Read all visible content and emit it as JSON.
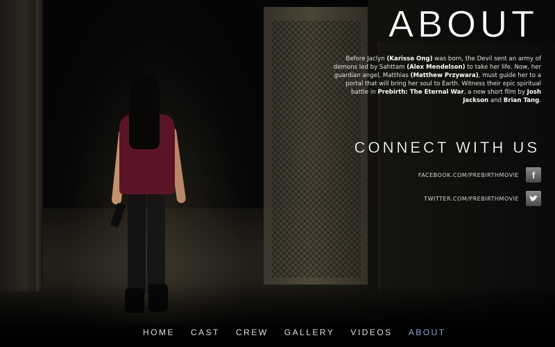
{
  "about": {
    "title": "ABOUT",
    "synopsis": [
      {
        "text": "Before Jaclyn ",
        "bold": false
      },
      {
        "text": "(Karissa Ong)",
        "bold": true
      },
      {
        "text": " was born, the Devil sent an army of demons led by Sahttam ",
        "bold": false
      },
      {
        "text": "(Alex Mendelson)",
        "bold": true
      },
      {
        "text": " to take her life. Now, her guardian angel, Matthias ",
        "bold": false
      },
      {
        "text": "(Matthew Przywara)",
        "bold": true
      },
      {
        "text": ", must guide her to a portal that will bring her soul to Earth. Witness their epic spiritual battle in ",
        "bold": false
      },
      {
        "text": "Prebirth: The Eternal War",
        "bold": true
      },
      {
        "text": ", a new short film by ",
        "bold": false
      },
      {
        "text": "Josh Jackson",
        "bold": true
      },
      {
        "text": " and ",
        "bold": false
      },
      {
        "text": "Brian Tang",
        "bold": true
      },
      {
        "text": ".",
        "bold": false
      }
    ]
  },
  "connect": {
    "title": "CONNECT WITH US",
    "facebook": {
      "text": "FACEBOOK.COM/PREBIRTHMOVIE",
      "icon": "facebook-icon",
      "glyph": "f"
    },
    "twitter": {
      "text": "TWITTER.COM/PREBIRTHMOVIE",
      "icon": "twitter-icon",
      "glyph": "🐦"
    }
  },
  "nav": {
    "items": [
      "HOME",
      "CAST",
      "CREW",
      "GALLERY",
      "VIDEOS",
      "ABOUT"
    ],
    "active": "ABOUT"
  },
  "colors": {
    "background": "#050505",
    "text": "#e6e6e6",
    "nav_active": "#8ea5d8"
  }
}
